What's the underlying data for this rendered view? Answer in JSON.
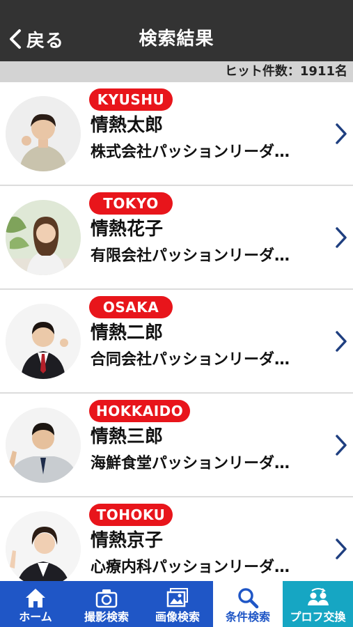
{
  "navbar": {
    "back_label": "戻る",
    "title": "検索結果"
  },
  "result_count": "ヒット件数：1911名",
  "results": [
    {
      "region": "KYUSHU",
      "name": "情熱太郎",
      "company": "株式会社パッションリーダ…"
    },
    {
      "region": "TOKYO",
      "name": "情熱花子",
      "company": "有限会社パッションリーダ…"
    },
    {
      "region": "OSAKA",
      "name": "情熱二郎",
      "company": "合同会社パッションリーダ…"
    },
    {
      "region": "HOKKAIDO",
      "name": "情熱三郎",
      "company": "海鮮食堂パッションリーダ…"
    },
    {
      "region": "TOHOKU",
      "name": "情熱京子",
      "company": "心療内科パッションリーダ…"
    }
  ],
  "tabs": [
    {
      "label": "ホーム",
      "icon": "home-icon"
    },
    {
      "label": "撮影検索",
      "icon": "camera-icon"
    },
    {
      "label": "画像検索",
      "icon": "image-icon"
    },
    {
      "label": "条件検索",
      "icon": "search-icon"
    },
    {
      "label": "プロフ交換",
      "icon": "people-exchange-icon"
    }
  ],
  "colors": {
    "navbar": "#333333",
    "badge": "#e8151b",
    "tab_blue": "#1f56c6",
    "tab_teal": "#16a6c3",
    "chevron": "#1f3f80"
  }
}
